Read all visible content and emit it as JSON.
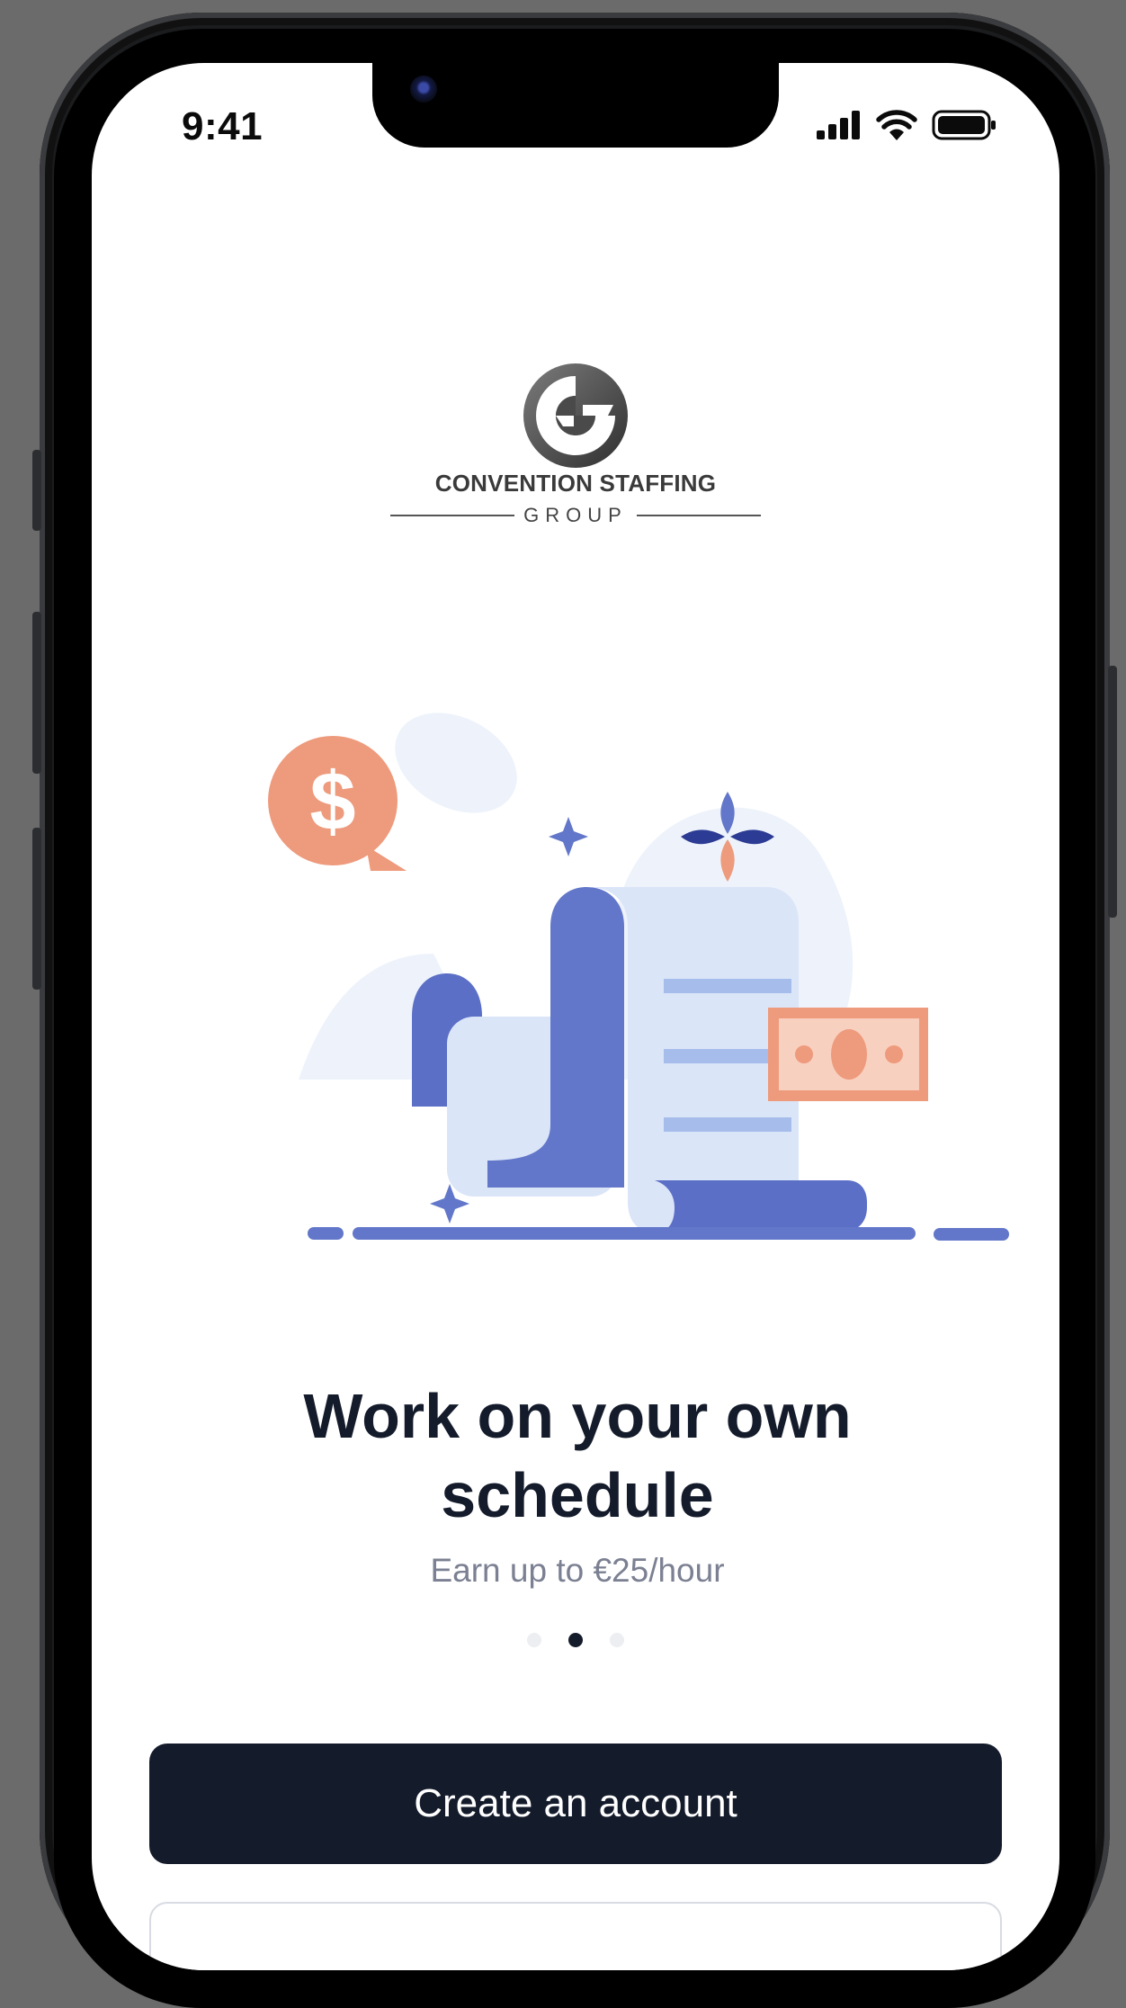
{
  "status_bar": {
    "time": "9:41"
  },
  "logo": {
    "company_name": "CONVENTION STAFFING",
    "company_sub": "GROUP"
  },
  "onboarding": {
    "headline_line1": "Work on your own",
    "headline_line2": "schedule",
    "subline": "Earn up to €25/hour",
    "page_count": 3,
    "active_page": 2
  },
  "actions": {
    "create_account_label": "Create an account"
  },
  "colors": {
    "primary": "#141b2b",
    "accent_blue": "#6277c9",
    "accent_orange": "#ee9a7c",
    "light_blue": "#dbe5f8"
  }
}
